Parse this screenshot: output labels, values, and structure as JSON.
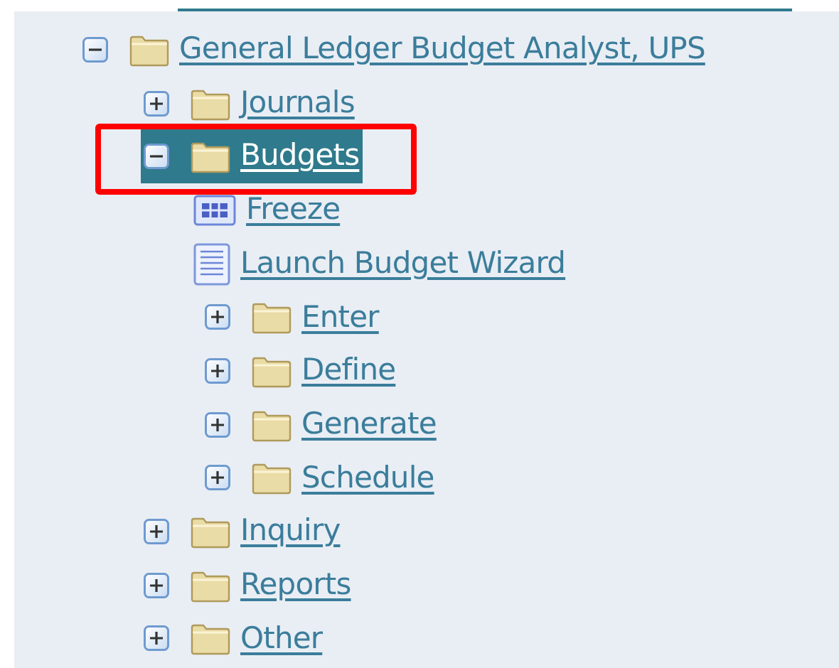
{
  "tree": [
    {
      "label": "General Ledger Budget Analyst, UPS",
      "kind": "folder",
      "expanded": true,
      "selected": false,
      "highlighted": false,
      "children": [
        {
          "label": "Journals",
          "kind": "folder",
          "expanded": false,
          "selected": false,
          "highlighted": false
        },
        {
          "label": "Budgets",
          "kind": "folder",
          "expanded": true,
          "selected": true,
          "highlighted": true,
          "children": [
            {
              "label": "Freeze",
              "kind": "form",
              "selected": false,
              "highlighted": false
            },
            {
              "label": "Launch Budget Wizard",
              "kind": "document",
              "selected": false,
              "highlighted": false
            },
            {
              "label": "Enter",
              "kind": "folder",
              "expanded": false,
              "selected": false,
              "highlighted": false
            },
            {
              "label": "Define",
              "kind": "folder",
              "expanded": false,
              "selected": false,
              "highlighted": false
            },
            {
              "label": "Generate",
              "kind": "folder",
              "expanded": false,
              "selected": false,
              "highlighted": false
            },
            {
              "label": "Schedule",
              "kind": "folder",
              "expanded": false,
              "selected": false,
              "highlighted": false
            }
          ]
        },
        {
          "label": "Inquiry",
          "kind": "folder",
          "expanded": false,
          "selected": false,
          "highlighted": false
        },
        {
          "label": "Reports",
          "kind": "folder",
          "expanded": false,
          "selected": false,
          "highlighted": false
        },
        {
          "label": "Other",
          "kind": "folder",
          "expanded": false,
          "selected": false,
          "highlighted": false
        }
      ]
    }
  ]
}
